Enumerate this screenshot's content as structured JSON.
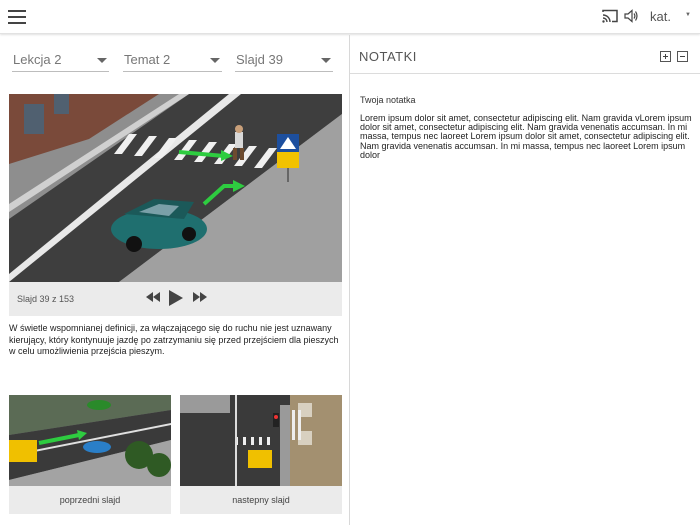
{
  "header": {
    "menu_icon": "hamburger-icon",
    "cast_icon": "cast-icon",
    "volume_icon": "volume-icon",
    "category_label": "kat."
  },
  "selectors": {
    "lesson": "Lekcja 2",
    "topic": "Temat 2",
    "slide": "Slajd 39"
  },
  "player": {
    "counter": "Slajd 39 z 153",
    "rewind_icon": "rewind-icon",
    "play_icon": "play-icon",
    "forward_icon": "fast-forward-icon"
  },
  "description": "W świetle wspomnianej definicji, za włączającego się do ruchu nie jest uznawany kierujący, który kontynuuje jazdę po zatrzymaniu się przed przejściem dla pieszych w celu umożliwienia przejścia pieszym.",
  "thumbnails": {
    "prev_label": "poprzedni slajd",
    "next_label": "nastepny slajd"
  },
  "notes": {
    "title": "NOTATKI",
    "expand_icon": "plus-box-icon",
    "collapse_icon": "minus-box-icon",
    "label": "Twoja notatka",
    "text": "Lorem ipsum dolor sit amet, consectetur  adipiscing elit. Nam gravida vLorem ipsum dolor sit amet, consectetur adipiscing elit. Nam gravida venenatis accumsan. In mi massa, tempus nec laoreet Lorem ipsum dolor sit amet, consectetur adipiscing elit. Nam gravida venenatis accumsan. In mi massa, tempus nec laoreet Lorem ipsum dolor"
  }
}
